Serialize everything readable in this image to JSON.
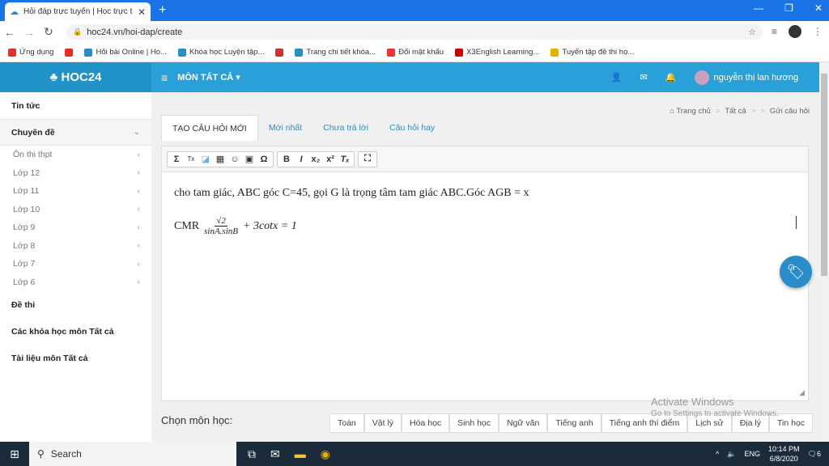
{
  "browser": {
    "tab_title": "Hỏi đáp trực tuyến | Học trực tuy",
    "url": "hoc24.vn/hoi-dap/create"
  },
  "bookmarks": [
    {
      "label": "Ứng dụng",
      "color": "#d33"
    },
    {
      "label": "",
      "color": "#e52d27"
    },
    {
      "label": "Hỏi bài Online | Ho...",
      "color": "#2a8cc8"
    },
    {
      "label": "Khóa học Luyện tập...",
      "color": "#2a8cc8"
    },
    {
      "label": "",
      "color": "#c33"
    },
    {
      "label": "Trang chi tiết khóa...",
      "color": "#2a8cc8"
    },
    {
      "label": "Đổi mật khẩu",
      "color": "#e33"
    },
    {
      "label": "X3English Learning...",
      "color": "#c00"
    },
    {
      "label": "Tuyển tập đề thi họ...",
      "color": "#e8b000"
    }
  ],
  "header": {
    "logo": "HOC24",
    "menu_label": "MÔN TẤT CẢ",
    "username": "nguyễn thị lan hương"
  },
  "sidebar": {
    "items": [
      {
        "label": "Tin tức",
        "type": "main"
      },
      {
        "label": "Chuyên đề",
        "type": "open"
      },
      {
        "label": "Ôn thi thpt",
        "type": "sub"
      },
      {
        "label": "Lớp 12",
        "type": "sub"
      },
      {
        "label": "Lớp 11",
        "type": "sub"
      },
      {
        "label": "Lớp 10",
        "type": "sub"
      },
      {
        "label": "Lớp 9",
        "type": "sub"
      },
      {
        "label": "Lớp 8",
        "type": "sub"
      },
      {
        "label": "Lớp 7",
        "type": "sub"
      },
      {
        "label": "Lớp 6",
        "type": "sub"
      },
      {
        "label": "Đề thi",
        "type": "main"
      },
      {
        "label": "Các khóa học môn Tất cả",
        "type": "main"
      },
      {
        "label": "Tài liệu môn Tất cả",
        "type": "main"
      }
    ]
  },
  "breadcrumb": {
    "home": "Trang chủ",
    "all": "Tất cả",
    "current": "Gửi câu hỏi"
  },
  "tabs": [
    {
      "label": "TẠO CÂU HỎI MỚI",
      "active": true
    },
    {
      "label": "Mới nhất",
      "active": false
    },
    {
      "label": "Chưa trả lời",
      "active": false
    },
    {
      "label": "Câu hỏi hay",
      "active": false
    }
  ],
  "editor": {
    "line1": "cho tam giác, ABC góc C=45, gọi G là trọng tâm tam giác ABC.Góc AGB = x",
    "line2_prefix": "CMR",
    "frac_num": "√2",
    "frac_den": "sinA.sinB",
    "line2_rest": "+ 3cotx = 1"
  },
  "subject_section": {
    "label": "Chọn môn học:",
    "subjects": [
      "Toán",
      "Vật lý",
      "Hóa học",
      "Sinh học",
      "Ngữ văn",
      "Tiếng anh",
      "Tiếng anh thí điểm",
      "Lịch sử",
      "Địa lý",
      "Tin học"
    ]
  },
  "watermark": {
    "title": "Activate Windows",
    "subtitle": "Go to Settings to activate Windows."
  },
  "taskbar": {
    "search_label": "Search",
    "lang": "ENG",
    "time": "10:14 PM",
    "date": "6/8/2020",
    "notif_count": "6"
  }
}
